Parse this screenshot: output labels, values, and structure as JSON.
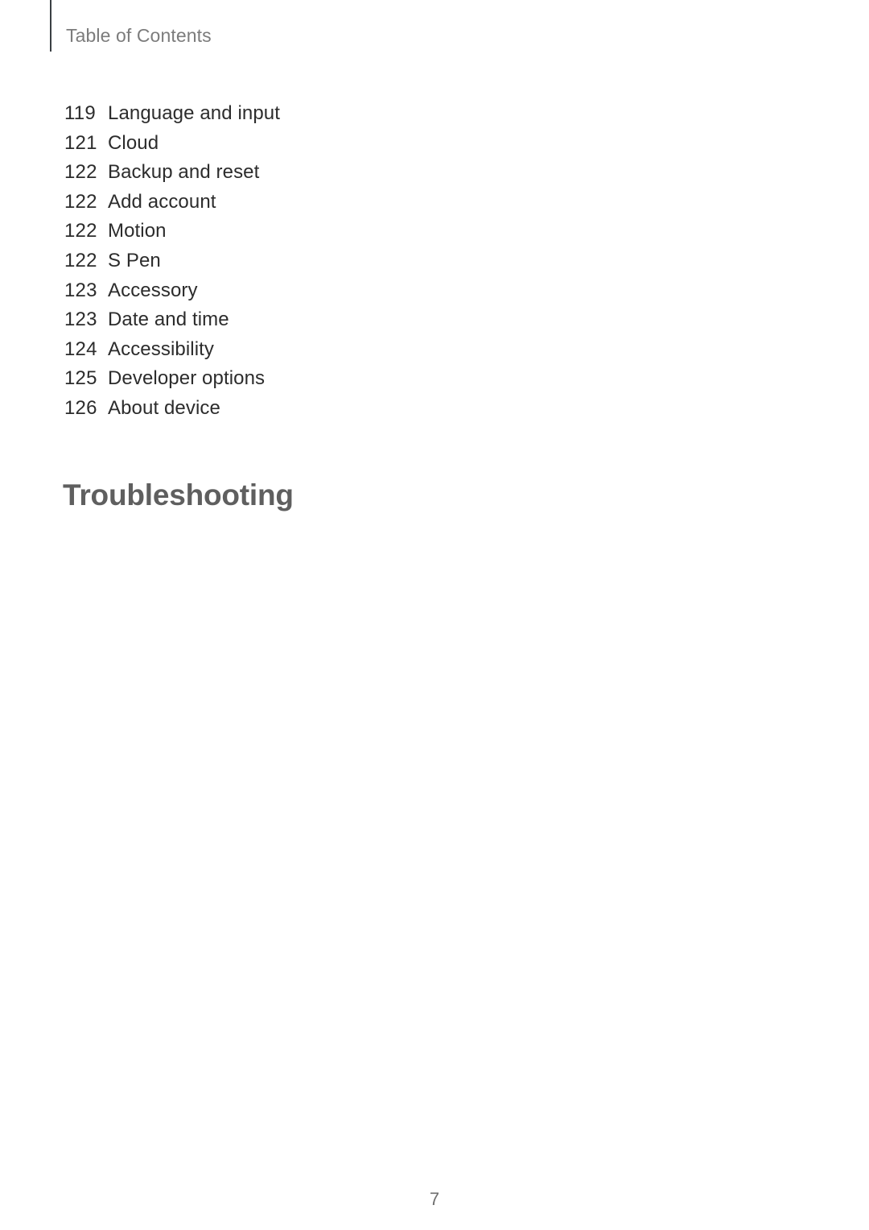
{
  "document": {
    "page_background": "#ffffff",
    "body_text_color": "#2c2c2c"
  },
  "header": {
    "title": "Table of Contents",
    "rule_color": "#3a3f43",
    "title_color": "#7c7c7c"
  },
  "toc": {
    "entries": [
      {
        "page": "119",
        "label": "Language and input"
      },
      {
        "page": "121",
        "label": "Cloud"
      },
      {
        "page": "122",
        "label": "Backup and reset"
      },
      {
        "page": "122",
        "label": "Add account"
      },
      {
        "page": "122",
        "label": "Motion"
      },
      {
        "page": "122",
        "label": "S Pen"
      },
      {
        "page": "123",
        "label": "Accessory"
      },
      {
        "page": "123",
        "label": "Date and time"
      },
      {
        "page": "124",
        "label": "Accessibility"
      },
      {
        "page": "125",
        "label": "Developer options"
      },
      {
        "page": "126",
        "label": "About device"
      }
    ]
  },
  "chapter": {
    "title": "Troubleshooting",
    "color": "#5f5f5f"
  },
  "footer": {
    "page_number": "7",
    "color": "#6f6f6f"
  }
}
